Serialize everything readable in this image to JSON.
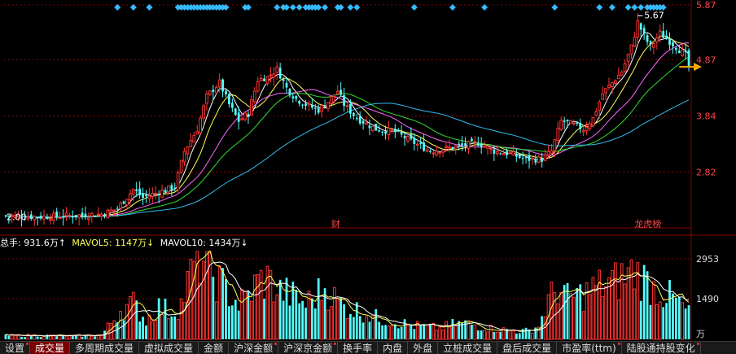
{
  "chart_data": [
    {
      "type": "candlestick",
      "title": "",
      "ylim": [
        1.8,
        5.9
      ],
      "y_ticks": [
        {
          "value": 5.87,
          "label": "5.87"
        },
        {
          "value": 4.87,
          "label": "4.87"
        },
        {
          "value": 3.84,
          "label": "3.84"
        },
        {
          "value": 2.82,
          "label": "2.82"
        }
      ],
      "annotations": {
        "high_label": "5.67",
        "low_label": "2.00",
        "event_markers": [
          {
            "x_index": 103,
            "text": "财"
          },
          {
            "x_index": 198,
            "text": "龙虎榜"
          }
        ],
        "current_price_arrow": 4.74,
        "signal_diamonds": [
          35,
          40,
          45,
          54,
          55,
          56,
          57,
          58,
          59,
          60,
          61,
          62,
          63,
          64,
          65,
          66,
          67,
          68,
          69,
          75,
          76,
          85,
          87,
          88,
          90,
          92,
          94,
          95,
          96,
          97,
          98,
          100,
          104,
          105,
          108,
          110,
          128,
          140,
          150,
          172,
          186,
          190,
          195,
          197,
          199,
          201,
          202,
          203,
          204,
          205,
          206
        ]
      },
      "price_waypoints": [
        [
          0,
          2.02
        ],
        [
          10,
          2.0
        ],
        [
          20,
          2.02
        ],
        [
          30,
          2.05
        ],
        [
          35,
          2.15
        ],
        [
          40,
          2.5
        ],
        [
          43,
          2.35
        ],
        [
          48,
          2.45
        ],
        [
          53,
          2.55
        ],
        [
          56,
          3.2
        ],
        [
          60,
          3.6
        ],
        [
          63,
          4.2
        ],
        [
          67,
          4.45
        ],
        [
          70,
          4.05
        ],
        [
          73,
          3.75
        ],
        [
          76,
          3.9
        ],
        [
          79,
          4.5
        ],
        [
          82,
          4.55
        ],
        [
          85,
          4.7
        ],
        [
          88,
          4.35
        ],
        [
          91,
          4.15
        ],
        [
          94,
          4.05
        ],
        [
          98,
          3.95
        ],
        [
          101,
          4.1
        ],
        [
          104,
          4.3
        ],
        [
          106,
          4.05
        ],
        [
          110,
          3.8
        ],
        [
          116,
          3.6
        ],
        [
          122,
          3.55
        ],
        [
          128,
          3.35
        ],
        [
          133,
          3.2
        ],
        [
          138,
          3.25
        ],
        [
          143,
          3.3
        ],
        [
          148,
          3.35
        ],
        [
          153,
          3.2
        ],
        [
          158,
          3.15
        ],
        [
          163,
          3.05
        ],
        [
          168,
          3.05
        ],
        [
          171,
          3.2
        ],
        [
          174,
          3.75
        ],
        [
          177,
          3.7
        ],
        [
          181,
          3.6
        ],
        [
          184,
          3.8
        ],
        [
          187,
          4.25
        ],
        [
          190,
          4.45
        ],
        [
          193,
          4.65
        ],
        [
          196,
          5.1
        ],
        [
          198,
          5.55
        ],
        [
          200,
          5.3
        ],
        [
          202,
          5.1
        ],
        [
          205,
          5.35
        ],
        [
          208,
          5.2
        ],
        [
          211,
          5.05
        ],
        [
          213,
          4.95
        ],
        [
          214,
          4.74
        ]
      ],
      "moving_averages": [
        {
          "name": "MA5",
          "color": "#ffffff"
        },
        {
          "name": "MA10",
          "color": "#ffff55"
        },
        {
          "name": "MA20",
          "color": "#ff66ff"
        },
        {
          "name": "MA30",
          "color": "#33dd33"
        },
        {
          "name": "MA60",
          "color": "#33bbee"
        }
      ]
    },
    {
      "type": "bar",
      "title": "",
      "labels": {
        "total_hand": "总手: 931.6万↑",
        "mavol5": "MAVOL5: 1147万↓",
        "mavol10": "MAVOL10: 1434万↓"
      },
      "y_ticks": [
        {
          "value": 2953,
          "label": "2953"
        },
        {
          "value": 1490,
          "label": "1490"
        }
      ],
      "unit": "万",
      "ylim": [
        0,
        3220
      ],
      "volume_waypoints": [
        [
          0,
          130
        ],
        [
          10,
          150
        ],
        [
          20,
          120
        ],
        [
          30,
          160
        ],
        [
          33,
          600
        ],
        [
          36,
          1100
        ],
        [
          40,
          1300
        ],
        [
          44,
          700
        ],
        [
          48,
          1200
        ],
        [
          52,
          1000
        ],
        [
          55,
          1300
        ],
        [
          58,
          2350
        ],
        [
          60,
          3100
        ],
        [
          62,
          2900
        ],
        [
          64,
          2500
        ],
        [
          67,
          2100
        ],
        [
          70,
          1700
        ],
        [
          73,
          1300
        ],
        [
          76,
          1600
        ],
        [
          79,
          2100
        ],
        [
          82,
          2200
        ],
        [
          85,
          1800
        ],
        [
          88,
          1700
        ],
        [
          91,
          1500
        ],
        [
          94,
          1300
        ],
        [
          97,
          1600
        ],
        [
          100,
          1900
        ],
        [
          103,
          1500
        ],
        [
          106,
          1200
        ],
        [
          109,
          1100
        ],
        [
          112,
          1000
        ],
        [
          116,
          800
        ],
        [
          120,
          700
        ],
        [
          124,
          600
        ],
        [
          128,
          500
        ],
        [
          132,
          450
        ],
        [
          136,
          400
        ],
        [
          140,
          550
        ],
        [
          144,
          600
        ],
        [
          148,
          500
        ],
        [
          152,
          400
        ],
        [
          156,
          350
        ],
        [
          160,
          300
        ],
        [
          164,
          320
        ],
        [
          167,
          500
        ],
        [
          170,
          1400
        ],
        [
          173,
          1900
        ],
        [
          176,
          1500
        ],
        [
          179,
          1600
        ],
        [
          182,
          1700
        ],
        [
          185,
          1900
        ],
        [
          188,
          2000
        ],
        [
          191,
          2100
        ],
        [
          194,
          2300
        ],
        [
          197,
          2500
        ],
        [
          200,
          2200
        ],
        [
          203,
          1900
        ],
        [
          206,
          1700
        ],
        [
          209,
          1500
        ],
        [
          212,
          1200
        ],
        [
          214,
          931.6
        ]
      ]
    }
  ],
  "tabs": [
    {
      "label": "设置",
      "dot": true
    },
    {
      "label": "成交量",
      "active": true
    },
    {
      "label": "多周期成交量"
    },
    {
      "label": "虚拟成交量"
    },
    {
      "label": "金额"
    },
    {
      "label": "沪深金额",
      "dot": true
    },
    {
      "label": "沪深京金额",
      "dot": true
    },
    {
      "label": "换手率"
    },
    {
      "label": "内盘"
    },
    {
      "label": "外盘"
    },
    {
      "label": "立桩成交量"
    },
    {
      "label": "盘后成交量"
    },
    {
      "label": "市盈率(ttm)",
      "dot": true
    },
    {
      "label": "陆股通持股变化",
      "dot": true
    }
  ],
  "colors": {
    "up": "#ff3333",
    "down": "#54ffff",
    "grid": "#8b0000",
    "axis_text": "#ff4444",
    "arrow": "#ffaa00"
  }
}
